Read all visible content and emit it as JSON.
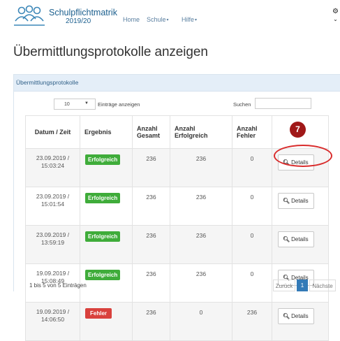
{
  "app": {
    "title": "Schulpflichtmatrik",
    "year": "2019/20"
  },
  "nav": {
    "items": [
      {
        "label": "Home"
      },
      {
        "label": "Schule"
      },
      {
        "label": "Hilfe"
      }
    ],
    "caret": "▾"
  },
  "page": {
    "title": "Übermittlungsprotokolle anzeigen"
  },
  "panel": {
    "heading": "Übermittlungsprotokolle"
  },
  "table_controls": {
    "length_value": "10",
    "length_label": "Einträge anzeigen",
    "search_label": "Suchen",
    "search_value": ""
  },
  "table": {
    "headers": {
      "datum": "Datum / Zeit",
      "ergebnis": "Ergebnis",
      "gesamt_1": "Anzahl",
      "gesamt_2": "Gesamt",
      "erfolgreich_1": "Anzahl",
      "erfolgreich_2": "Erfolgreich",
      "fehler_1": "Anzahl",
      "fehler_2": "Fehler"
    },
    "rows": [
      {
        "date": "23.09.2019 /",
        "time": "15:03:24",
        "result": "Erfolgreich",
        "status": "ok",
        "gesamt": "236",
        "erfolgreich": "236",
        "fehler": "0",
        "action": "Details"
      },
      {
        "date": "23.09.2019 /",
        "time": "15:01:54",
        "result": "Erfolgreich",
        "status": "ok",
        "gesamt": "236",
        "erfolgreich": "236",
        "fehler": "0",
        "action": "Details"
      },
      {
        "date": "23.09.2019 /",
        "time": "13:59:19",
        "result": "Erfolgreich",
        "status": "ok",
        "gesamt": "236",
        "erfolgreich": "236",
        "fehler": "0",
        "action": "Details"
      },
      {
        "date": "19.09.2019 /",
        "time": "15:08:49",
        "result": "Erfolgreich",
        "status": "ok",
        "gesamt": "236",
        "erfolgreich": "236",
        "fehler": "0",
        "action": "Details"
      },
      {
        "date": "19.09.2019 /",
        "time": "14:06:50",
        "result": "Fehler",
        "status": "error",
        "gesamt": "236",
        "erfolgreich": "0",
        "fehler": "236",
        "action": "Details"
      }
    ]
  },
  "annotation": {
    "step_number": "7",
    "color": "#a01818",
    "highlight_color": "#d92c2c"
  },
  "footer": {
    "info": "1 bis 5 von 5 Einträgen",
    "prev": "Zurück",
    "current_page": "1",
    "next": "Nächste"
  },
  "colors": {
    "success": "#3fac3a",
    "error": "#d9413d",
    "primary": "#337ab7",
    "panel_heading": "#e4eef8"
  },
  "icons": {
    "logo": "people-group-logo",
    "details": "magnifier-icon",
    "user_menu": "gear-icon"
  }
}
